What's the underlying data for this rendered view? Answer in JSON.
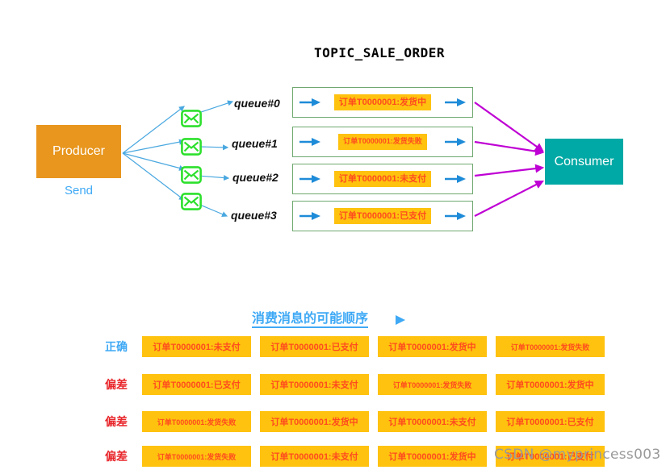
{
  "topic": {
    "title": "TOPIC_SALE_ORDER"
  },
  "producer": {
    "label": "Producer",
    "send_label": "Send",
    "color": "#E8961E"
  },
  "consumer": {
    "label": "Consumer",
    "color": "#00A9A5"
  },
  "queues": [
    {
      "label": "queue#0",
      "message": "订单T0000001:发货中",
      "icon": "envelope-icon"
    },
    {
      "label": "queue#1",
      "message": "订单T0000001:发货失败",
      "icon": "envelope-icon"
    },
    {
      "label": "queue#2",
      "message": "订单T0000001:未支付",
      "icon": "envelope-icon"
    },
    {
      "label": "queue#3",
      "message": "订单T0000001:已支付",
      "icon": "envelope-icon"
    }
  ],
  "order_section": {
    "heading": "消费消息的可能顺序",
    "rows": [
      {
        "tag": "正确",
        "tag_type": "correct",
        "cells": [
          "订单T0000001:未支付",
          "订单T0000001:已支付",
          "订单T0000001:发货中",
          "订单T0000001:发货失败"
        ]
      },
      {
        "tag": "偏差",
        "tag_type": "deviation",
        "cells": [
          "订单T0000001:已支付",
          "订单T0000001:未支付",
          "订单T0000001:发货失败",
          "订单T0000001:发货中"
        ]
      },
      {
        "tag": "偏差",
        "tag_type": "deviation",
        "cells": [
          "订单T0000001:发货失败",
          "订单T0000001:发货中",
          "订单T0000001:未支付",
          "订单T0000001:已支付"
        ]
      },
      {
        "tag": "偏差",
        "tag_type": "deviation",
        "cells": [
          "订单T0000001:发货失败",
          "订单T0000001:未支付",
          "订单T0000001:发货中",
          "订单T0000001:已支付"
        ]
      }
    ]
  },
  "watermark": {
    "text": "CSDN @myprincess003"
  },
  "colors": {
    "orange_chip": "#FFC20E",
    "chip_text": "#FF4B1F",
    "blue": "#3FA9F5",
    "green_border": "#6FA86F",
    "envelope_green": "#2DE02D",
    "magenta": "#BF00D4",
    "red": "#E8262B"
  }
}
